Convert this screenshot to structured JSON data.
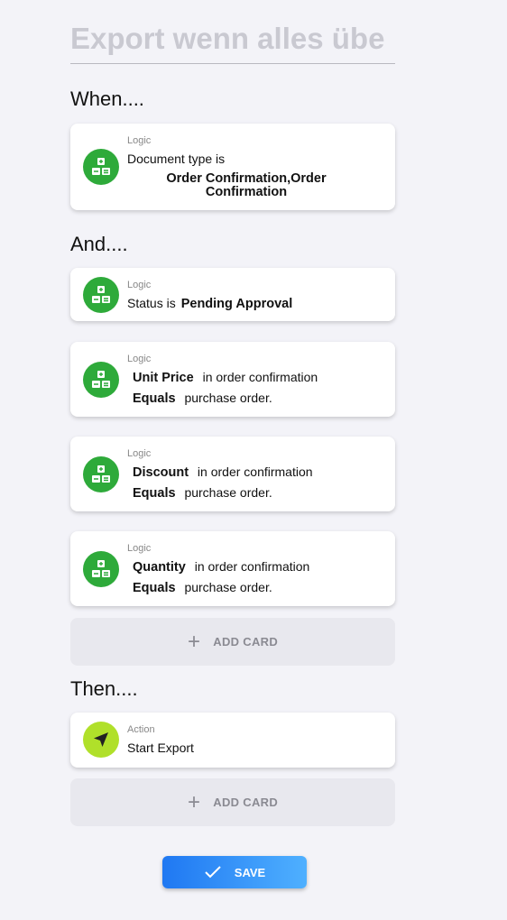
{
  "title": "Export wenn alles übe",
  "sections": {
    "when": "When....",
    "and": "And....",
    "then": "Then...."
  },
  "when_card": {
    "category": "Logic",
    "text": "Document type is",
    "value": "Order Confirmation,Order Confirmation"
  },
  "and_cards": [
    {
      "category": "Logic",
      "text": "Status is",
      "value": "Pending Approval"
    },
    {
      "category": "Logic",
      "field": "Unit Price",
      "text": "in order confirmation",
      "op": "Equals",
      "text2": "purchase order."
    },
    {
      "category": "Logic",
      "field": "Discount",
      "text": "in order confirmation",
      "op": "Equals",
      "text2": "purchase order."
    },
    {
      "category": "Logic",
      "field": "Quantity",
      "text": "in order confirmation",
      "op": "Equals",
      "text2": "purchase order."
    }
  ],
  "then_card": {
    "category": "Action",
    "text": "Start Export"
  },
  "add_card_label": "ADD CARD",
  "save_label": "SAVE",
  "colors": {
    "logic": "#2eaa3a",
    "action": "#b0e02a",
    "save": "#1f78f2"
  }
}
